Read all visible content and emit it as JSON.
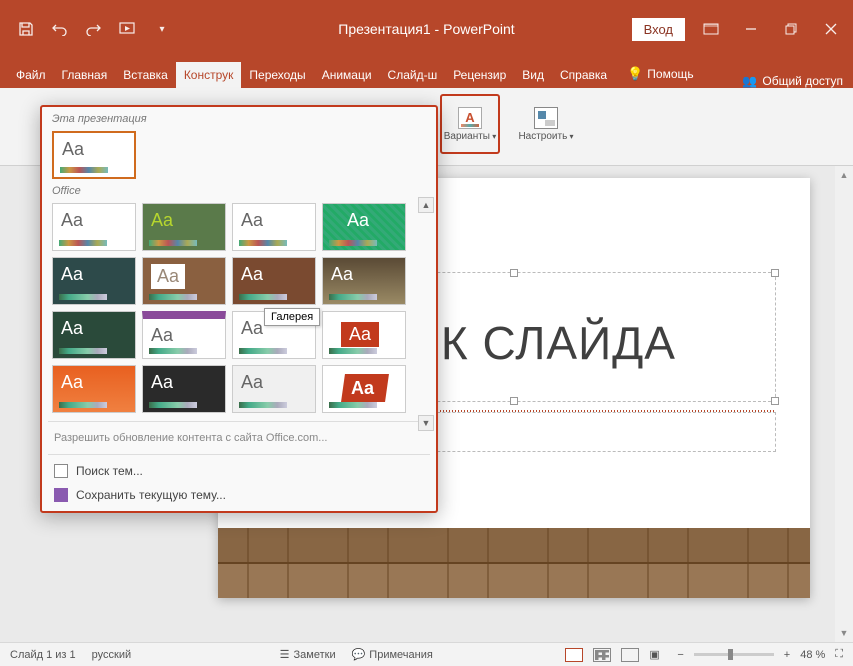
{
  "titlebar": {
    "app_title": "Презентация1 - PowerPoint",
    "login": "Вход"
  },
  "qat": {
    "save": "save",
    "undo": "undo",
    "redo": "redo",
    "start": "start-from-beginning"
  },
  "window": {
    "min": "minimize",
    "max": "restore-down",
    "close": "close",
    "ribbon_opts": "ribbon-display-options"
  },
  "tabs": {
    "file": "Файл",
    "home": "Главная",
    "insert": "Вставка",
    "design": "Конструк",
    "transitions": "Переходы",
    "animations": "Анимаци",
    "slideshow": "Слайд-ш",
    "review": "Рецензир",
    "view": "Вид",
    "help": "Справка",
    "tell_me": "Помощь",
    "share": "Общий доступ"
  },
  "ribbon": {
    "variants": "Варианты",
    "variants_icon_text": "A",
    "customize": "Настроить"
  },
  "theme_gallery": {
    "section_this": "Эта презентация",
    "section_office": "Office",
    "current_thumb_text": "Aa",
    "thumbs": [
      {
        "aa": "Aa",
        "cls": ""
      },
      {
        "aa": "Aa",
        "cls": "tt-green"
      },
      {
        "aa": "Aa",
        "cls": ""
      },
      {
        "aa": "Aa",
        "cls": "tt-pattern"
      },
      {
        "aa": "Aa",
        "cls": "tt-dark"
      },
      {
        "aa": "Aa",
        "cls": "tt-wood"
      },
      {
        "aa": "Aa",
        "cls": "tt-brown"
      },
      {
        "aa": "Aa",
        "cls": "tt-gradient"
      },
      {
        "aa": "Aa",
        "cls": "tt-greendk"
      },
      {
        "aa": "Aa",
        "cls": "tt-purple"
      },
      {
        "aa": "Aa",
        "cls": ""
      },
      {
        "aa": "Aa",
        "cls": "tt-red"
      },
      {
        "aa": "Aa",
        "cls": "tt-orange"
      },
      {
        "aa": "Aa",
        "cls": "tt-black"
      },
      {
        "aa": "Aa",
        "cls": "tt-gallery"
      },
      {
        "aa": "Aa",
        "cls": "tt-redcard"
      }
    ],
    "tooltip": "Галерея",
    "enable_updates": "Разрешить обновление контента с сайта Office.com...",
    "search_themes": "Поиск тем...",
    "save_theme": "Сохранить текущую тему..."
  },
  "slide": {
    "title": "ВОК СЛАЙДА"
  },
  "statusbar": {
    "slide_count": "Слайд 1 из 1",
    "language": "русский",
    "notes": "Заметки",
    "comments": "Примечания",
    "zoom_value": "48 %"
  }
}
